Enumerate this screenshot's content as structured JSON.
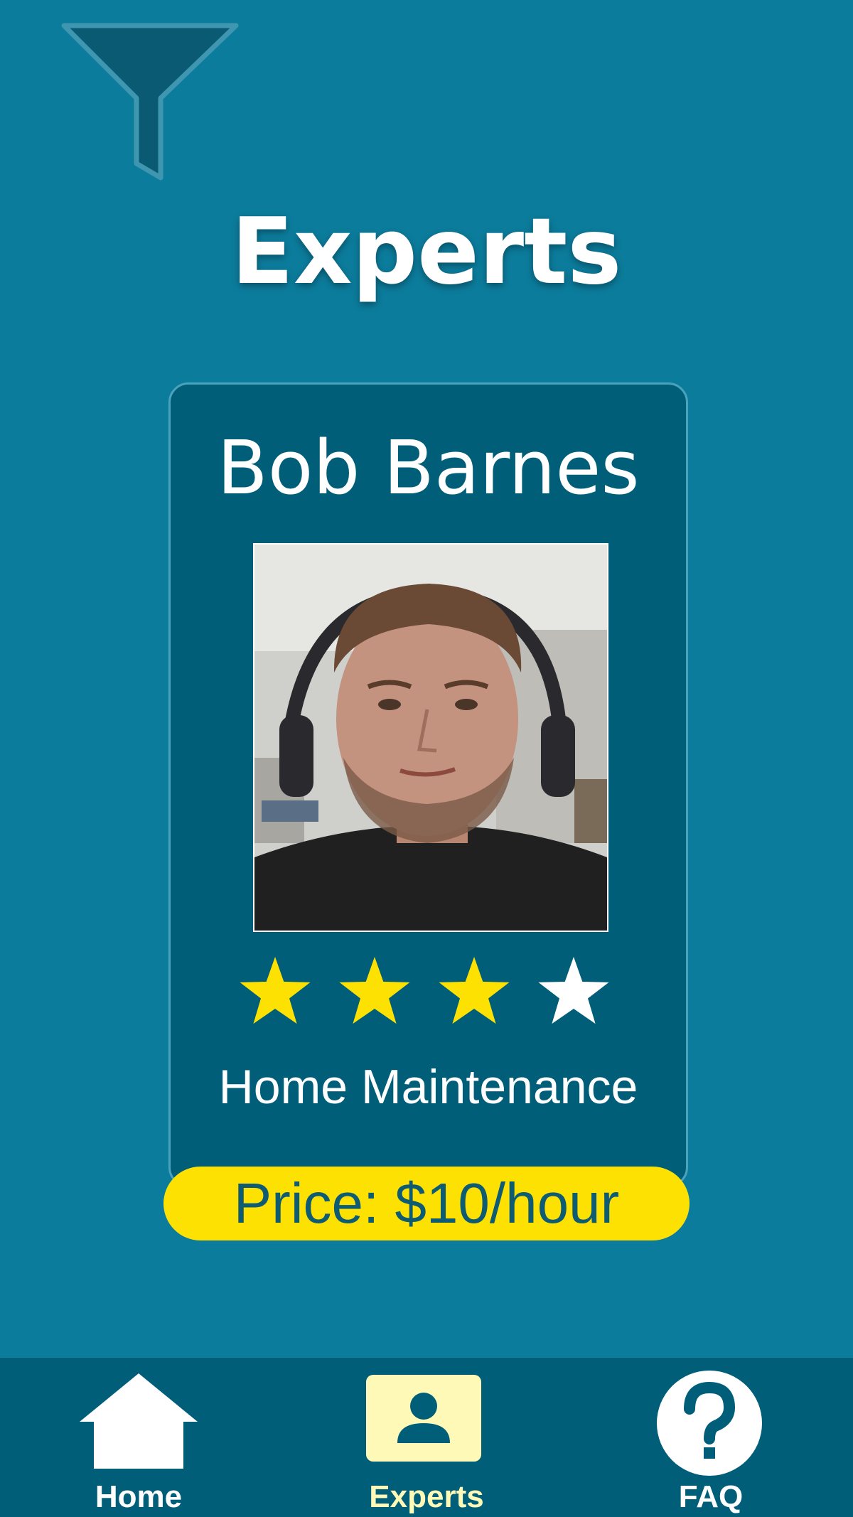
{
  "header": {
    "filter_icon": "filter-funnel-icon",
    "title": "Experts"
  },
  "expert_card": {
    "name": "Bob Barnes",
    "photo_icon": "expert-portrait",
    "rating": 3,
    "rating_max": 4,
    "specialty": "Home Maintenance",
    "price_label": "Price: $10/hour"
  },
  "bottom_nav": {
    "active": "experts",
    "items": [
      {
        "id": "home",
        "label": "Home",
        "icon": "home-icon"
      },
      {
        "id": "experts",
        "label": "Experts",
        "icon": "person-icon"
      },
      {
        "id": "faq",
        "label": "FAQ",
        "icon": "question-mark-icon"
      }
    ]
  },
  "colors": {
    "background": "#0c7c9c",
    "card": "#015e79",
    "accent_yellow": "#fde102",
    "star_filled": "#fde102",
    "star_empty": "#ffffff",
    "nav_active_bg": "#fef9b7"
  }
}
